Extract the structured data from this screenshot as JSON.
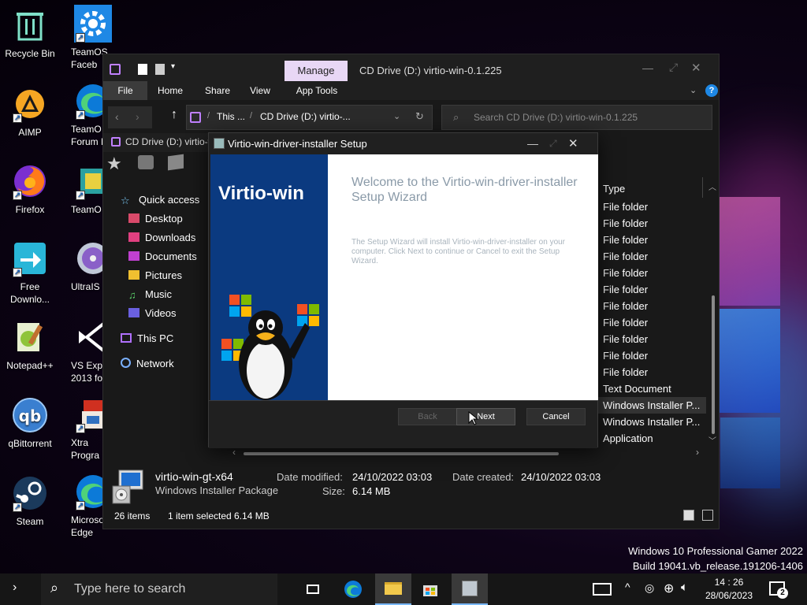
{
  "desktop": {
    "icons_left": [
      {
        "name": "recycle-bin",
        "label": "Recycle Bin"
      },
      {
        "name": "aimp",
        "label": "AIMP"
      },
      {
        "name": "firefox",
        "label": "Firefox"
      },
      {
        "name": "free-download-manager",
        "label": "Free Downlo..."
      },
      {
        "name": "notepad-plus-plus",
        "label": "Notepad++"
      },
      {
        "name": "qbittorrent",
        "label": "qBittorrent"
      },
      {
        "name": "steam",
        "label": "Steam"
      }
    ],
    "icons_right": [
      {
        "name": "teamos-facebook",
        "label": "TeamOS Faceb"
      },
      {
        "name": "teamos-forum",
        "label": "TeamO Forum L"
      },
      {
        "name": "teamos",
        "label": "TeamO"
      },
      {
        "name": "ultraiso",
        "label": "UltraIS"
      },
      {
        "name": "vs-express",
        "label": "VS Expr 2013 fo"
      },
      {
        "name": "xtra-programs",
        "label": "Xtra Progra"
      },
      {
        "name": "microsoft-edge",
        "label": "Microso Edge"
      }
    ]
  },
  "explorer": {
    "manage_tab": "Manage",
    "title": "CD Drive (D:) virtio-win-0.1.225",
    "ribbon_tabs": [
      "File",
      "Home",
      "Share",
      "View",
      "App Tools"
    ],
    "address": {
      "crumb1": "This ...",
      "crumb2": "CD Drive (D:) virtio-..."
    },
    "search_placeholder": "Search CD Drive (D:) virtio-win-0.1.225",
    "behind_tab_label": "CD Drive (D:) virtio-wi",
    "nav": [
      {
        "name": "quick-access",
        "label": "Quick access",
        "icon": "star-icon"
      },
      {
        "name": "desktop",
        "label": "Desktop",
        "icon": "desktop-folder-icon"
      },
      {
        "name": "downloads",
        "label": "Downloads",
        "icon": "downloads-folder-icon"
      },
      {
        "name": "documents",
        "label": "Documents",
        "icon": "documents-folder-icon"
      },
      {
        "name": "pictures",
        "label": "Pictures",
        "icon": "pictures-folder-icon"
      },
      {
        "name": "music",
        "label": "Music",
        "icon": "music-icon"
      },
      {
        "name": "videos",
        "label": "Videos",
        "icon": "videos-folder-icon"
      },
      {
        "name": "this-pc",
        "label": "This PC",
        "icon": "pc-icon"
      },
      {
        "name": "network",
        "label": "Network",
        "icon": "network-icon"
      }
    ],
    "type_header": "Type",
    "types": [
      "File folder",
      "File folder",
      "File folder",
      "File folder",
      "File folder",
      "File folder",
      "File folder",
      "File folder",
      "File folder",
      "File folder",
      "File folder",
      "Text Document",
      "Windows Installer P...",
      "Windows Installer P...",
      "Application"
    ],
    "details": {
      "filename": "virtio-win-gt-x64",
      "filetype": "Windows Installer Package",
      "modified_label": "Date modified:",
      "modified_value": "24/10/2022 03:03",
      "size_label": "Size:",
      "size_value": "6.14 MB",
      "created_label": "Date created:",
      "created_value": "24/10/2022 03:03"
    },
    "status": {
      "items": "26 items",
      "selected": "1 item selected  6.14 MB"
    }
  },
  "setup": {
    "title": "Virtio-win-driver-installer Setup",
    "banner_title": "Virtio-win",
    "heading": "Welcome to the Virtio-win-driver-installer Setup Wizard",
    "body": "The Setup Wizard will install Virtio-win-driver-installer on your computer. Click Next to continue or Cancel to exit the Setup Wizard.",
    "back": "Back",
    "next": "Next",
    "cancel": "Cancel"
  },
  "watermark": {
    "line1": "Windows 10 Professional Gamer 2022",
    "line2": "Build 19041.vb_release.191206-1406"
  },
  "taskbar": {
    "search_placeholder": "Type here to search",
    "time": "14 : 26",
    "date": "28/06/2023",
    "notification_count": "2"
  },
  "colors": {
    "accent": "#0078d4",
    "manage_tab": "#e8d7f5",
    "banner": "#0b3a80"
  }
}
